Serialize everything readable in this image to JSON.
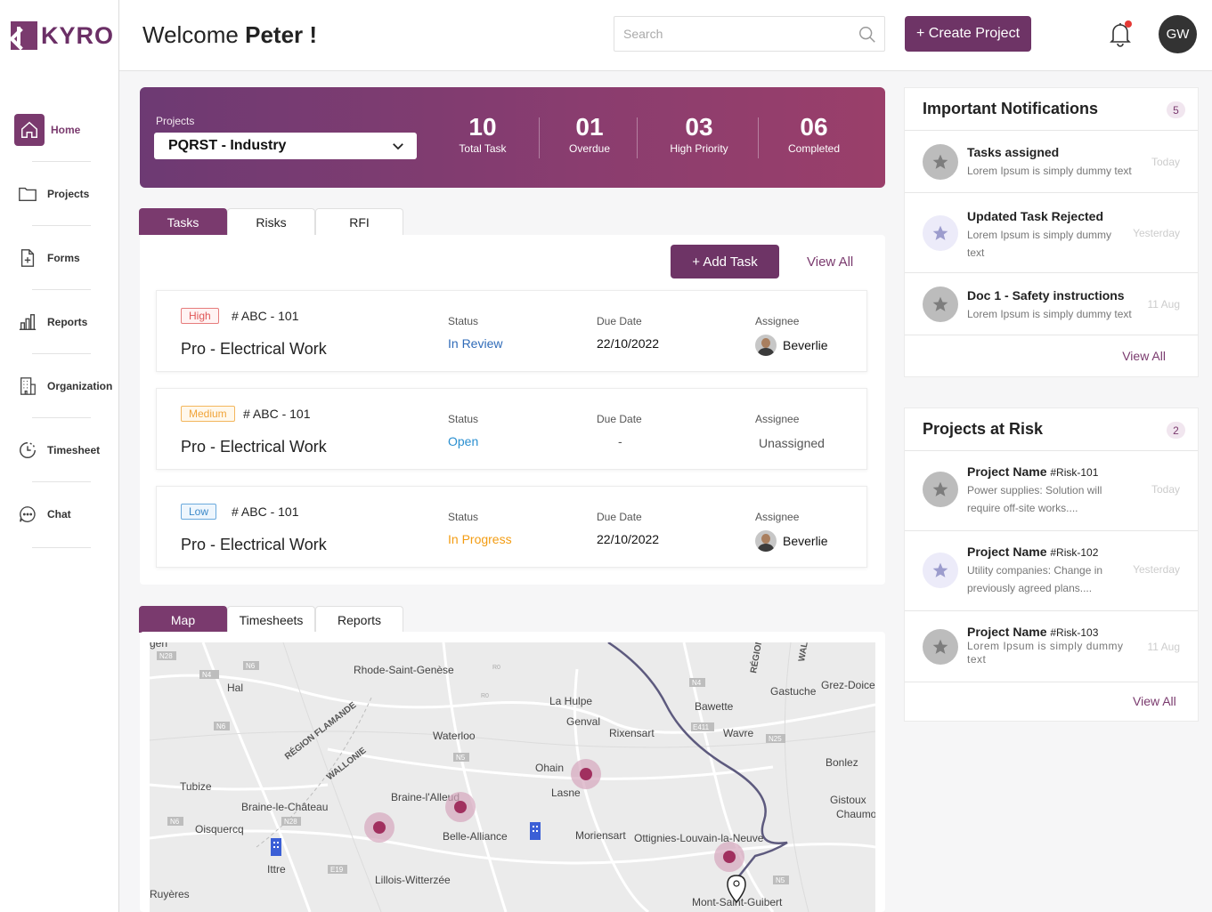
{
  "brand": {
    "name": "KYRO"
  },
  "sidebar": {
    "items": [
      {
        "label": "Home",
        "icon": "home-icon",
        "active": true
      },
      {
        "label": "Projects",
        "icon": "folder-icon"
      },
      {
        "label": "Forms",
        "icon": "form-add-icon"
      },
      {
        "label": "Reports",
        "icon": "bar-chart-icon"
      },
      {
        "label": "Organization",
        "icon": "building-icon"
      },
      {
        "label": "Timesheet",
        "icon": "clock-history-icon"
      },
      {
        "label": "Chat",
        "icon": "chat-bubble-icon"
      }
    ]
  },
  "header": {
    "welcome_prefix": "Welcome",
    "user_name": "Peter !",
    "search_placeholder": "Search",
    "create_button": "+ Create Project",
    "avatar_initials": "GW"
  },
  "project_summary": {
    "label": "Projects",
    "selected_project": "PQRST - Industry",
    "stats": [
      {
        "value": "10",
        "label": "Total Task"
      },
      {
        "value": "01",
        "label": "Overdue"
      },
      {
        "value": "03",
        "label": "High Priority"
      },
      {
        "value": "06",
        "label": "Completed"
      }
    ]
  },
  "task_tabs": [
    "Tasks",
    "Risks",
    "RFI"
  ],
  "task_actions": {
    "add_task": "+ Add Task",
    "view_all": "View All"
  },
  "tasks": [
    {
      "priority": "High",
      "id": "# ABC - 101",
      "title": "Pro - Electrical Work",
      "status_label": "Status",
      "status": "In Review",
      "status_color": "#2f6bb8",
      "due_label": "Due Date",
      "due": "22/10/2022",
      "assignee_label": "Assignee",
      "assignee": "Beverlie"
    },
    {
      "priority": "Medium",
      "id": "# ABC - 101",
      "title": "Pro - Electrical Work",
      "status_label": "Status",
      "status": "Open",
      "status_color": "#2a8fd0",
      "due_label": "Due Date",
      "due": "-",
      "assignee_label": "Assignee",
      "assignee": "Unassigned"
    },
    {
      "priority": "Low",
      "id": "# ABC - 101",
      "title": "Pro - Electrical Work",
      "status_label": "Status",
      "status": "In Progress",
      "status_color": "#f39c12",
      "due_label": "Due Date",
      "due": "22/10/2022",
      "assignee_label": "Assignee",
      "assignee": "Beverlie"
    }
  ],
  "bottom_tabs": [
    "Map",
    "Timesheets",
    "Reports"
  ],
  "map": {
    "places": [
      "Rhode-Saint-Genèse",
      "Hal",
      "La Hulpe",
      "Genval",
      "Waterloo",
      "Rixensart",
      "Wavre",
      "Bawette",
      "Gastuche",
      "Grez-Doiceau",
      "RÉGION FLAMANDE",
      "WALLONIE",
      "Ohain",
      "Lasne",
      "Braine-l'Alleud",
      "Tubize",
      "Braine-le-Château",
      "Oisquercq",
      "Belle-Alliance",
      "Mont-Saint-Guibert",
      "Ottignies-Louvain-la-Neuve",
      "Moriensart",
      "Bonlez",
      "Gistoux",
      "Chaumont",
      "Ittre",
      "Lillois-Witterzée",
      "Ruyères",
      "RÉGION",
      "WAL",
      "gen"
    ],
    "roads": [
      "N28",
      "N6",
      "R0",
      "N4",
      "N5",
      "N25",
      "N28",
      "E19",
      "N6",
      "E411",
      "N4",
      "N5"
    ]
  },
  "notifications": {
    "title": "Important Notifications",
    "count": "5",
    "items": [
      {
        "title": "Tasks assigned",
        "desc": "Lorem Ipsum is simply dummy text",
        "time": "Today"
      },
      {
        "title": "Updated Task Rejected",
        "desc": "Lorem Ipsum is simply dummy text",
        "time": "Yesterday"
      },
      {
        "title": "Doc 1 - Safety instructions",
        "desc": "Lorem Ipsum is simply dummy text",
        "time": "11 Aug"
      }
    ],
    "view_all": "View All"
  },
  "risks": {
    "title": "Projects at Risk",
    "count": "2",
    "items": [
      {
        "name": "Project Name",
        "ref": "#Risk-101",
        "desc": "Power supplies: Solution will require off-site works....",
        "time": "Today"
      },
      {
        "name": "Project Name",
        "ref": "#Risk-102",
        "desc": "Utility companies: Change in previously agreed plans....",
        "time": "Yesterday"
      },
      {
        "name": "Project Name",
        "ref": "#Risk-103",
        "desc": "Lorem Ipsum is simply dummy text",
        "time": "11 Aug"
      }
    ],
    "view_all": "View All"
  },
  "colors": {
    "brand": "#7a3a6e",
    "accent": "#6e3466"
  }
}
